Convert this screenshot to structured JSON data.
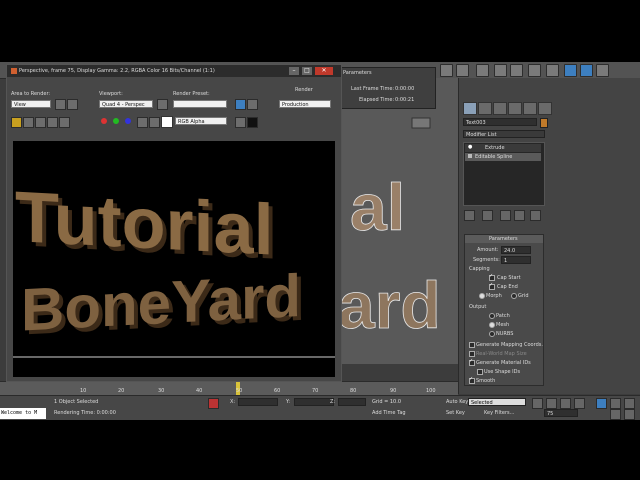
{
  "app": {
    "accent": "#3d7fc0",
    "window_bg": "#3c3c3c"
  },
  "render_window": {
    "title": "Perspective, frame 75, Display Gamma: 2.2, RGBA Color 16 Bits/Channel (1:1)",
    "area_to_render_label": "Area to Render:",
    "area_to_render_value": "View",
    "viewport_label": "Viewport:",
    "viewport_value": "Quad 4 - Perspec",
    "render_preset_label": "Render Preset:",
    "render_preset_value": "",
    "render_button": "Render",
    "render_mode_value": "Production",
    "channel_value": "RGB Alpha",
    "rendered_text": {
      "line1": "Tutorial",
      "line2": "BoneYard"
    }
  },
  "params_window": {
    "title": "Parameters",
    "last_frame_label": "Last Frame Time:",
    "last_frame_value": "0:00:00",
    "elapsed_label": "Elapsed Time:",
    "elapsed_value": "0:00:21"
  },
  "viewport": {
    "text1": "al",
    "text2": "ard"
  },
  "command_panel": {
    "object_name": "Text003",
    "modifier_list": "Modifier List",
    "stack": [
      {
        "label": "Extrude"
      },
      {
        "label": "Editable Spline"
      }
    ],
    "parameters_title": "Parameters",
    "amount_label": "Amount:",
    "amount_value": "24.0",
    "segments_label": "Segments:",
    "segments_value": "1",
    "capping_label": "Capping",
    "cap_start": "Cap Start",
    "cap_end": "Cap End",
    "morph": "Morph",
    "grid": "Grid",
    "output_label": "Output",
    "patch": "Patch",
    "mesh": "Mesh",
    "nurbs": "NURBS",
    "gen_mapping": "Generate Mapping Coords.",
    "real_world": "Real-World Map Size",
    "gen_material": "Generate Material IDs",
    "use_shape_ids": "Use Shape IDs",
    "smooth": "Smooth"
  },
  "timeline": {
    "ticks": [
      "0",
      "10",
      "20",
      "30",
      "40",
      "50",
      "60",
      "70",
      "80",
      "90",
      "100"
    ],
    "current": "75"
  },
  "status": {
    "maxscript": "Welcome to M",
    "selection": "1 Object Selected",
    "rendering_time": "Rendering Time: 0:00:00",
    "x_label": "X:",
    "y_label": "Y:",
    "z_label": "Z:",
    "grid": "Grid = 10.0",
    "add_time_tag": "Add Time Tag",
    "auto_key": "Auto Key",
    "selected": "Selected",
    "set_key": "Set Key",
    "key_filters": "Key Filters...",
    "frame_value": "75"
  }
}
